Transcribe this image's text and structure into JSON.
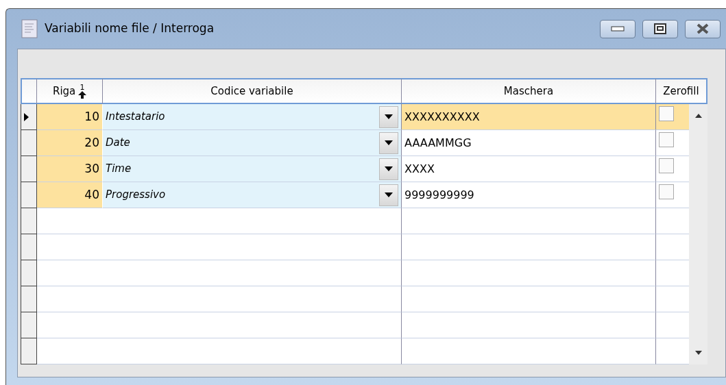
{
  "window": {
    "title": "Variabili nome file / Interroga"
  },
  "columns": [
    {
      "label": "Riga",
      "sort_order": "1"
    },
    {
      "label": "Codice variabile"
    },
    {
      "label": "Maschera"
    },
    {
      "label": "Zerofill"
    }
  ],
  "rows": [
    {
      "riga": "10",
      "codice": "Intestatario",
      "maschera": "XXXXXXXXXX",
      "zerofill": false,
      "selected": true
    },
    {
      "riga": "20",
      "codice": "Date",
      "maschera": "AAAAMMGG",
      "zerofill": false,
      "selected": false
    },
    {
      "riga": "30",
      "codice": "Time",
      "maschera": "XXXX",
      "zerofill": false,
      "selected": false
    },
    {
      "riga": "40",
      "codice": "Progressivo",
      "maschera": "9999999999",
      "zerofill": false,
      "selected": false
    }
  ]
}
